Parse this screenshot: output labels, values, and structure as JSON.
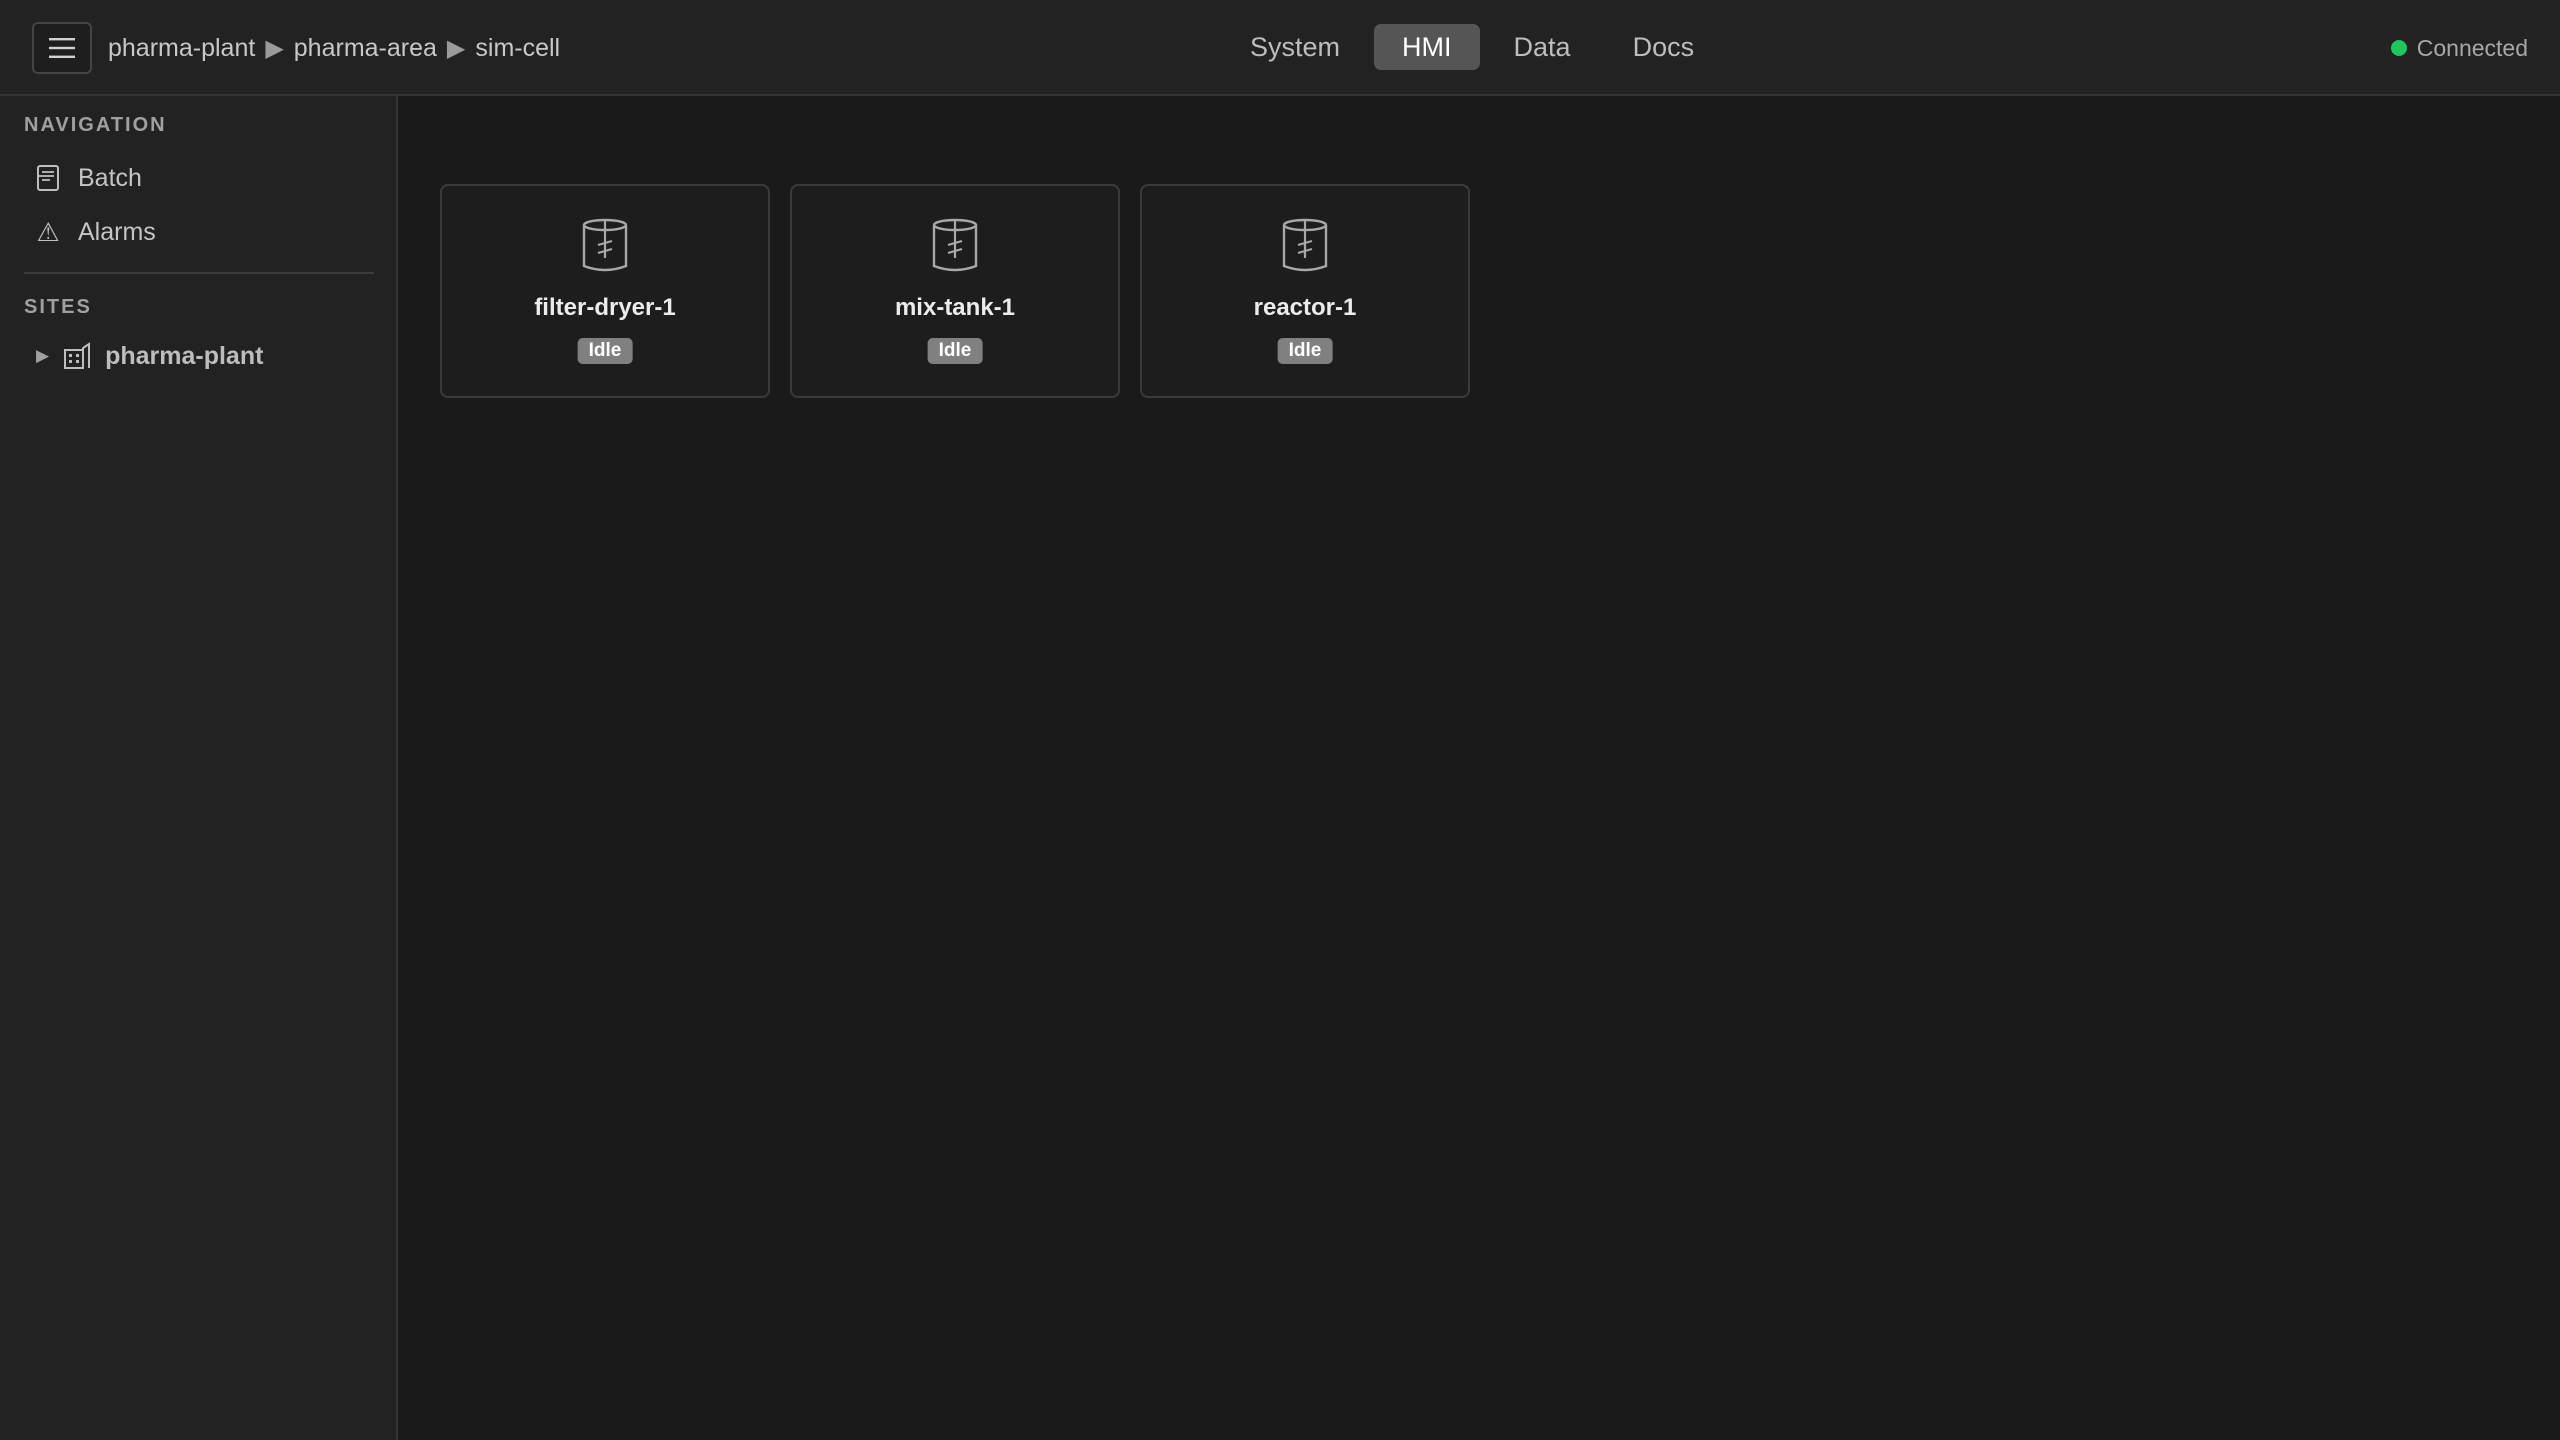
{
  "header": {
    "breadcrumb": [
      "pharma-plant",
      "pharma-area",
      "sim-cell"
    ],
    "breadcrumb_separator": "▶",
    "tabs": [
      {
        "label": "System",
        "active": false
      },
      {
        "label": "HMI",
        "active": true
      },
      {
        "label": "Data",
        "active": false
      },
      {
        "label": "Docs",
        "active": false
      }
    ],
    "connection": {
      "label": "Connected",
      "color": "#22c55e"
    }
  },
  "sidebar": {
    "navigation_title": "NAVIGATION",
    "items": [
      {
        "label": "Batch",
        "icon": "document-icon"
      },
      {
        "label": "Alarms",
        "icon": "warning-icon",
        "glyph": "⚠"
      }
    ],
    "sites_title": "SITES",
    "sites": [
      {
        "label": "pharma-plant",
        "icon": "building-icon",
        "expander": "▶"
      }
    ]
  },
  "units": [
    {
      "name": "filter-dryer-1",
      "status": "Idle",
      "icon": "vessel-icon"
    },
    {
      "name": "mix-tank-1",
      "status": "Idle",
      "icon": "vessel-icon"
    },
    {
      "name": "reactor-1",
      "status": "Idle",
      "icon": "vessel-icon"
    }
  ],
  "colors": {
    "accent_tab": "#555555",
    "status_idle": "#808080",
    "connected": "#22c55e"
  }
}
